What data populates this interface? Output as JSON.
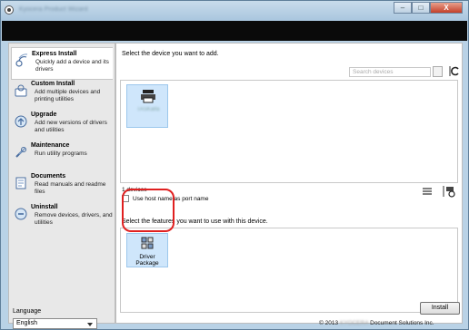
{
  "window": {
    "title": "Kyocera Product Wizard",
    "minimize": "–",
    "maximize": "□",
    "close": "X"
  },
  "sidebar": {
    "items": [
      {
        "title": "Express Install",
        "desc": "Quickly add a device and its drivers",
        "icon": "express-install-icon"
      },
      {
        "title": "Custom Install",
        "desc": "Add multiple devices and printing utilities",
        "icon": "custom-install-icon"
      },
      {
        "title": "Upgrade",
        "desc": "Add new versions of drivers and utilities",
        "icon": "upgrade-icon"
      },
      {
        "title": "Maintenance",
        "desc": "Run utility programs",
        "icon": "maintenance-icon"
      },
      {
        "title": "Documents",
        "desc": "Read manuals and readme files",
        "icon": "documents-icon"
      },
      {
        "title": "Uninstall",
        "desc": "Remove devices, drivers, and utilities",
        "icon": "uninstall-icon"
      }
    ],
    "language_label": "Language",
    "language_value": "English"
  },
  "main": {
    "instruction": "Select the device you want to add.",
    "search_placeholder": "Search devices",
    "device_name": "TASKalfa",
    "device_count": "1 devices",
    "host_name_option": "Use host name as port name",
    "feature_instruction": "Select the features you want to use with this device.",
    "feature_label": "Driver Package",
    "install_label": "Install"
  },
  "footer": {
    "prefix": "© 2013",
    "blurred": "KYOCERA",
    "suffix": "Document Solutions Inc."
  },
  "colors": {
    "accent_tile": "#cfe6fb",
    "highlight": "#e02020",
    "banner": "#0a0a0a"
  }
}
